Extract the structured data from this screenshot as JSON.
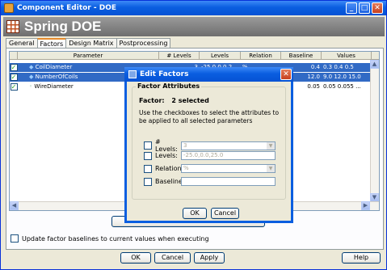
{
  "window": {
    "title": "Component Editor - DOE"
  },
  "banner": {
    "title": "Spring DOE"
  },
  "tabs": [
    {
      "label": "General"
    },
    {
      "label": "Factors"
    },
    {
      "label": "Design Matrix"
    },
    {
      "label": "Postprocessing"
    }
  ],
  "grid": {
    "columns": [
      "Parameter",
      "# Levels",
      "Levels",
      "Relation",
      "Baseline",
      "Values"
    ],
    "rows": [
      {
        "name": "CoilDiameter",
        "levels_count": "3",
        "levels": "-25.0,0.0,2...",
        "relation": "%",
        "baseline": "0.4",
        "values": "0.3 0.4 0.5"
      },
      {
        "name": "NumberOfCoils",
        "levels_count": "",
        "levels": "",
        "relation": "",
        "baseline": "12.0",
        "values": "9.0 12.0 15.0"
      },
      {
        "name": "WireDiameter",
        "levels_count": "",
        "levels": "",
        "relation": "",
        "baseline": "0.05",
        "values": "0.05 0.055 ..."
      }
    ]
  },
  "options": {
    "update_baselines": "Update factor baselines to current values when executing"
  },
  "footer": {
    "ok": "OK",
    "cancel": "Cancel",
    "apply": "Apply",
    "help": "Help"
  },
  "dialog": {
    "title": "Edit Factors",
    "group": "Factor Attributes",
    "factor_label": "Factor:",
    "factor_value": "2 selected",
    "instructions": "Use the checkboxes to select the attributes to be applied to all selected parameters",
    "levels_count_label": "# Levels:",
    "levels_count_value": "3",
    "levels_label": "Levels:",
    "levels_value": "-25.0,0.0,25.0",
    "relation_label": "Relation:",
    "relation_value": "%",
    "baseline_label": "Baseline:",
    "baseline_value": "",
    "ok": "OK",
    "cancel": "Cancel"
  }
}
